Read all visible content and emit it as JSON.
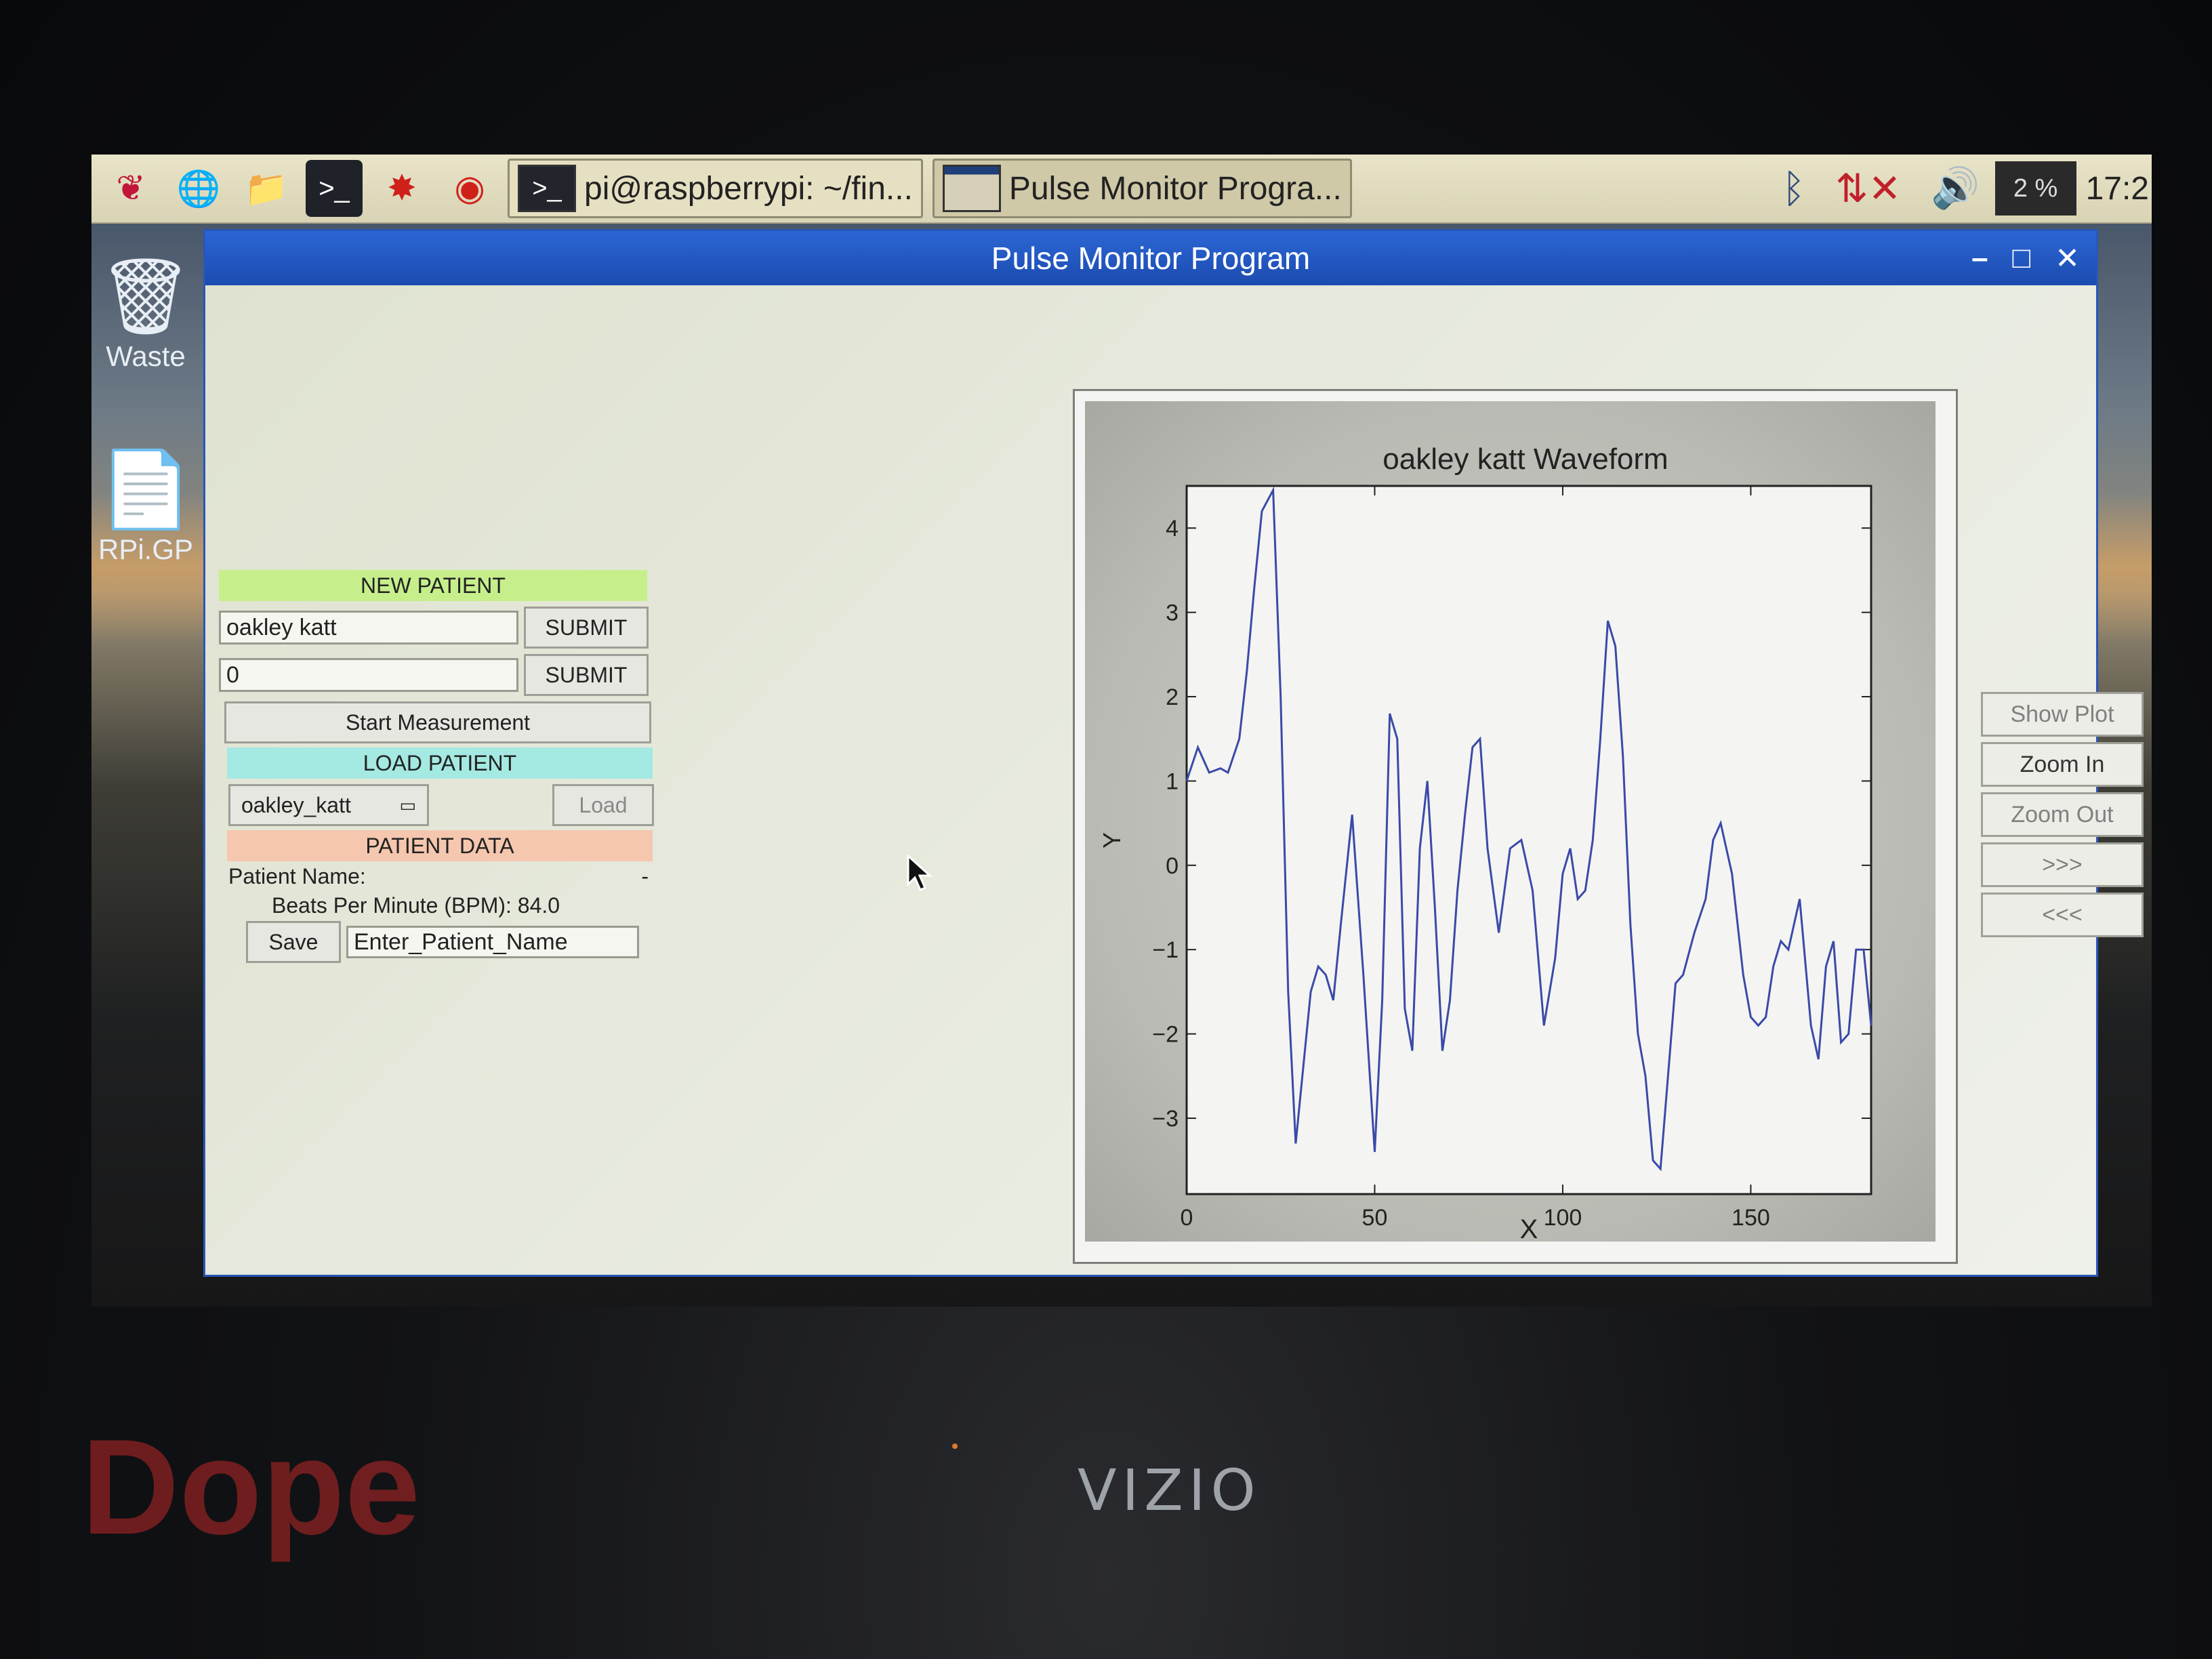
{
  "taskbar": {
    "tasks": [
      {
        "label": "pi@raspberrypi: ~/fin..."
      },
      {
        "label": "Pulse Monitor Progra..."
      }
    ],
    "cpu": "2 %",
    "clock": "17:2"
  },
  "desktop": {
    "icons": [
      {
        "label": "Waste"
      },
      {
        "label": "RPi.GP"
      }
    ]
  },
  "window": {
    "title": "Pulse Monitor Program"
  },
  "new_patient": {
    "header": "NEW PATIENT",
    "name_value": "oakley katt",
    "submit_label": "SUBMIT",
    "id_value": "0",
    "submit2_label": "SUBMIT",
    "start_label": "Start Measurement"
  },
  "load_patient": {
    "header": "LOAD PATIENT",
    "selected": "oakley_katt",
    "load_label": "Load"
  },
  "patient_data": {
    "header": "PATIENT DATA",
    "name_label": "Patient Name:",
    "name_value": "-",
    "bpm_text": "Beats Per Minute (BPM):  84.0",
    "save_label": "Save",
    "save_value": "Enter_Patient_Name"
  },
  "nav": {
    "show_plot": "Show Plot",
    "zoom_in": "Zoom In",
    "zoom_out": "Zoom Out",
    "next": ">>>",
    "prev": "<<<"
  },
  "chart_data": {
    "type": "line",
    "title": "oakley katt Waveform",
    "xlabel": "X",
    "ylabel": "Y",
    "xlim": [
      0,
      182
    ],
    "ylim": [
      -3.9,
      4.5
    ],
    "xticks": [
      0,
      50,
      100,
      150
    ],
    "yticks": [
      4,
      3,
      2,
      1,
      0,
      -1,
      -2,
      -3
    ],
    "ytick_labels": [
      "4",
      "3",
      "2",
      "1",
      "0",
      "−1",
      "−2",
      "−3"
    ],
    "line_color": "#3a4aa8",
    "series": [
      {
        "x": [
          0,
          3,
          6,
          9,
          11,
          14,
          16,
          18,
          20,
          23,
          25,
          27,
          29,
          31,
          33,
          35,
          37,
          39,
          41,
          44,
          47,
          50,
          52,
          54,
          56,
          58,
          60,
          62,
          64,
          66,
          68,
          70,
          72,
          74,
          76,
          78,
          80,
          83,
          86,
          89,
          92,
          95,
          98,
          100,
          102,
          104,
          106,
          108,
          110,
          112,
          114,
          116,
          118,
          120,
          122,
          124,
          126,
          128,
          130,
          132,
          135,
          138,
          140,
          142,
          145,
          148,
          150,
          152,
          154,
          156,
          158,
          160,
          163,
          166,
          168,
          170,
          172,
          174,
          176,
          178,
          180,
          182
        ],
        "y": [
          1.0,
          1.4,
          1.1,
          1.15,
          1.1,
          1.5,
          2.3,
          3.3,
          4.2,
          4.45,
          2.0,
          -1.5,
          -3.3,
          -2.4,
          -1.5,
          -1.2,
          -1.3,
          -1.6,
          -0.7,
          0.6,
          -1.3,
          -3.4,
          -1.6,
          1.8,
          1.5,
          -1.7,
          -2.2,
          0.2,
          1.0,
          -0.5,
          -2.2,
          -1.6,
          -0.3,
          0.6,
          1.4,
          1.5,
          0.2,
          -0.8,
          0.2,
          0.3,
          -0.3,
          -1.9,
          -1.1,
          -0.1,
          0.2,
          -0.4,
          -0.3,
          0.3,
          1.5,
          2.9,
          2.6,
          1.3,
          -0.7,
          -2.0,
          -2.5,
          -3.5,
          -3.6,
          -2.5,
          -1.4,
          -1.3,
          -0.8,
          -0.4,
          0.3,
          0.5,
          -0.1,
          -1.3,
          -1.8,
          -1.9,
          -1.8,
          -1.2,
          -0.9,
          -1.0,
          -0.4,
          -1.9,
          -2.3,
          -1.2,
          -0.9,
          -2.1,
          -2.0,
          -1.0,
          -1.0,
          -1.9
        ]
      }
    ]
  },
  "bezel": {
    "brand": "VIZIO",
    "sticker": "Dope"
  }
}
